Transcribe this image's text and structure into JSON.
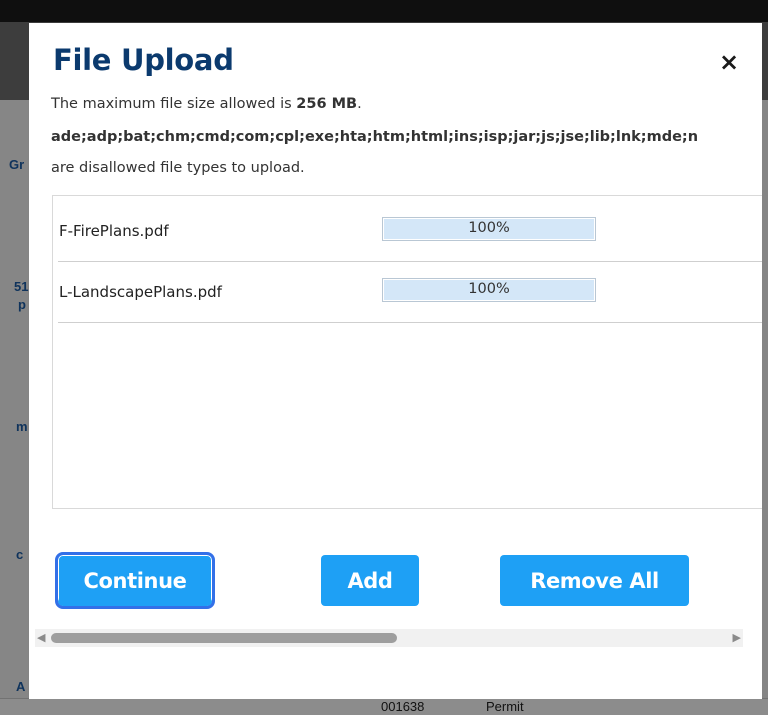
{
  "background": {
    "fragments": [
      "Gr",
      "51",
      "p",
      "m",
      "c",
      "A"
    ],
    "bottom_row": {
      "number": "001638",
      "type": "Permit"
    }
  },
  "dialog": {
    "title": "File Upload",
    "close_glyph": "×",
    "size_prefix": "The maximum file size allowed is ",
    "size_value": "256 MB",
    "size_suffix": ".",
    "disallowed_types": "ade;adp;bat;chm;cmd;com;cpl;exe;hta;htm;html;ins;isp;jar;js;jse;lib;lnk;mde;n",
    "disallowed_note": "are disallowed file types to upload.",
    "files": [
      {
        "name": "F-FirePlans.pdf",
        "progress_label": "100%",
        "progress": 1.0
      },
      {
        "name": "L-LandscapePlans.pdf",
        "progress_label": "100%",
        "progress": 1.0
      }
    ],
    "buttons": {
      "continue": "Continue",
      "add": "Add",
      "remove_all": "Remove All"
    },
    "scrollbar": {
      "left_arrow": "◀",
      "right_arrow": "▶"
    }
  },
  "colors": {
    "title": "#0b3a6e",
    "button": "#1ea0f5",
    "focus_ring": "#3370e8",
    "progress_fill": "#d4e7f8"
  }
}
